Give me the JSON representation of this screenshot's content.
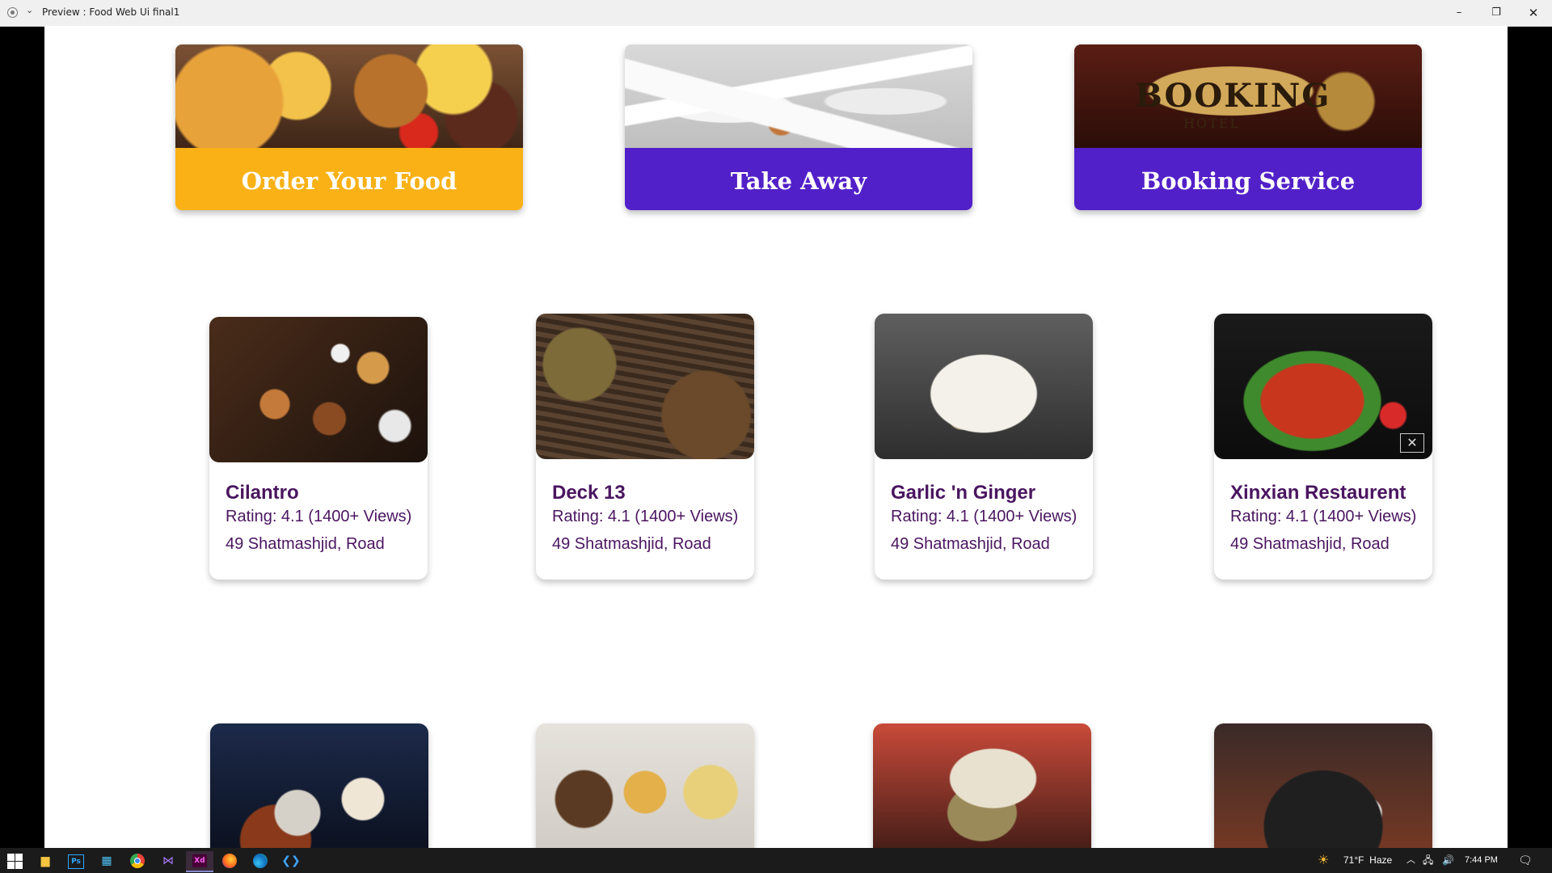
{
  "window": {
    "title": "Preview : Food Web Ui final1",
    "minimize_glyph": "–",
    "maximize_glyph": "❐",
    "close_glyph": "✕",
    "menu_glyph": "⌄"
  },
  "services": [
    {
      "label": "Order Your Food",
      "color": "#f9b116"
    },
    {
      "label": "Take Away",
      "color": "#5220c8"
    },
    {
      "label": "Booking Service",
      "color": "#5220c8",
      "sign_text": "BOOKING",
      "sign_sub": "HOTEL"
    }
  ],
  "restaurants": [
    {
      "name": "Cilantro",
      "rating": "Rating: 4.1 (1400+ Views)",
      "address": "49 Shatmashjid, Road"
    },
    {
      "name": "Deck 13",
      "rating": "Rating: 4.1 (1400+ Views)",
      "address": "49 Shatmashjid, Road"
    },
    {
      "name": "Garlic 'n Ginger",
      "rating": "Rating: 4.1 (1400+ Views)",
      "address": "49 Shatmashjid, Road"
    },
    {
      "name": "Xinxian Restaurent",
      "rating": "Rating: 4.1 (1400+ Views)",
      "address": "49 Shatmashjid, Road"
    }
  ],
  "taskbar": {
    "apps": [
      "windows-start",
      "file-explorer",
      "photoshop",
      "microsoft-store",
      "chrome",
      "visual-studio",
      "adobe-xd",
      "firefox",
      "edge",
      "vscode"
    ],
    "ps_text": "Ps",
    "xd_text": "Xd",
    "weather_temp": "71°F",
    "weather_desc": "Haze",
    "time": "7:44 PM",
    "tray_up_glyph": "︿",
    "tray_net_glyph": "🖧",
    "tray_vol_glyph": "🔊",
    "tray_notif_glyph": "🗨"
  }
}
